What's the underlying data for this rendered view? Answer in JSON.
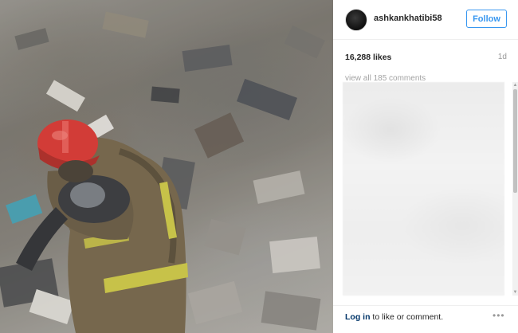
{
  "post": {
    "username": "ashkankhatibi58",
    "follow_label": "Follow",
    "likes": "16,288 likes",
    "time_ago": "1d",
    "view_comments": "view all 185 comments",
    "login_link": "Log in",
    "login_suffix": " to like or comment.",
    "more_glyph": "•••"
  },
  "photo": {
    "description_icon": "post-photo"
  },
  "colors": {
    "accent": "#3897f0",
    "link": "#003569",
    "muted": "#999999",
    "helmet": "#d42a25",
    "jacket": "#6b5a3e",
    "reflective": "#c8c23a"
  }
}
